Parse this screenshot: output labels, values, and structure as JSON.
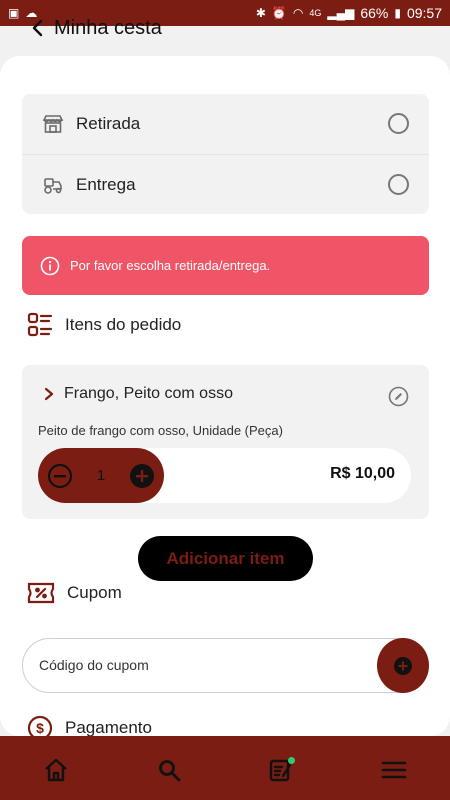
{
  "status_bar": {
    "battery": "66%",
    "time": "09:57",
    "network": "4G"
  },
  "header": {
    "title": "Minha cesta"
  },
  "delivery_options": [
    {
      "label": "Retirada",
      "icon": "store-icon",
      "selected": false
    },
    {
      "label": "Entrega",
      "icon": "tractor-icon",
      "selected": false
    }
  ],
  "alert": {
    "message": "Por favor escolha retirada/entrega.",
    "icon": "info-icon",
    "color": "#ef5566"
  },
  "order_items": {
    "title": "Itens do pedido",
    "items": [
      {
        "name": "Frango, Peito com osso",
        "description": "Peito de frango com osso, Unidade (Peça)",
        "quantity": "1",
        "price": "R$ 10,00"
      }
    ]
  },
  "add_item_label": "Adicionar item",
  "coupon": {
    "title": "Cupom",
    "placeholder": "Código do cupom"
  },
  "payment": {
    "title": "Pagamento"
  },
  "bottom_nav": [
    {
      "icon": "home-icon"
    },
    {
      "icon": "search-icon"
    },
    {
      "icon": "orders-icon",
      "badge": true
    },
    {
      "icon": "menu-icon"
    }
  ],
  "colors": {
    "brand": "#7b1d12",
    "alert": "#ef5566",
    "background": "#f1f1f1",
    "card": "#f2f2f2"
  }
}
